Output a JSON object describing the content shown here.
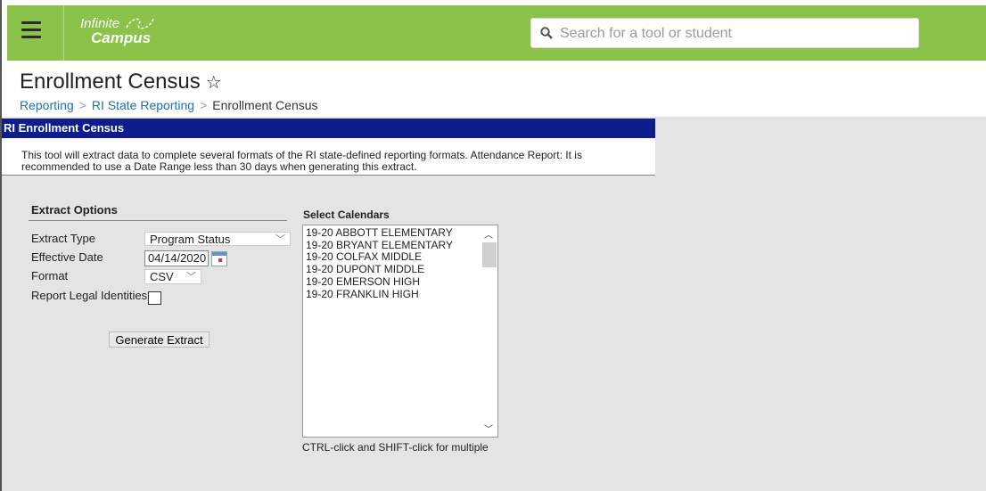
{
  "header": {
    "logo_line1": "Infinite",
    "logo_line2": "Campus",
    "search_placeholder": "Search for a tool or student"
  },
  "page": {
    "title": "Enrollment Census",
    "breadcrumb": [
      "Reporting",
      "RI State Reporting",
      "Enrollment Census"
    ]
  },
  "panel": {
    "header": "RI Enrollment Census",
    "description_line1": "This tool will extract data to complete several formats of the RI state-defined reporting formats. Attendance Report: It is",
    "description_line2": "recommended to use a Date Range less than 30 days when generating this extract."
  },
  "options": {
    "heading": "Extract Options",
    "extract_type_label": "Extract Type",
    "extract_type_value": "Program Status",
    "effective_date_label": "Effective Date",
    "effective_date_value": "04/14/2020",
    "format_label": "Format",
    "format_value": "CSV",
    "legal_identities_label": "Report Legal Identities",
    "generate_button": "Generate Extract"
  },
  "calendars": {
    "heading": "Select Calendars",
    "items": [
      "19-20 ABBOTT ELEMENTARY",
      "19-20 BRYANT ELEMENTARY",
      "19-20 COLFAX MIDDLE",
      "19-20 DUPONT MIDDLE",
      "19-20 EMERSON HIGH",
      "19-20 FRANKLIN HIGH"
    ],
    "hint": "CTRL-click and SHIFT-click for multiple"
  },
  "colors": {
    "topbar": "#8bc34a",
    "panel_header": "#0d1d8c",
    "link": "#1e6fb8",
    "background": "#e4e4e4"
  }
}
